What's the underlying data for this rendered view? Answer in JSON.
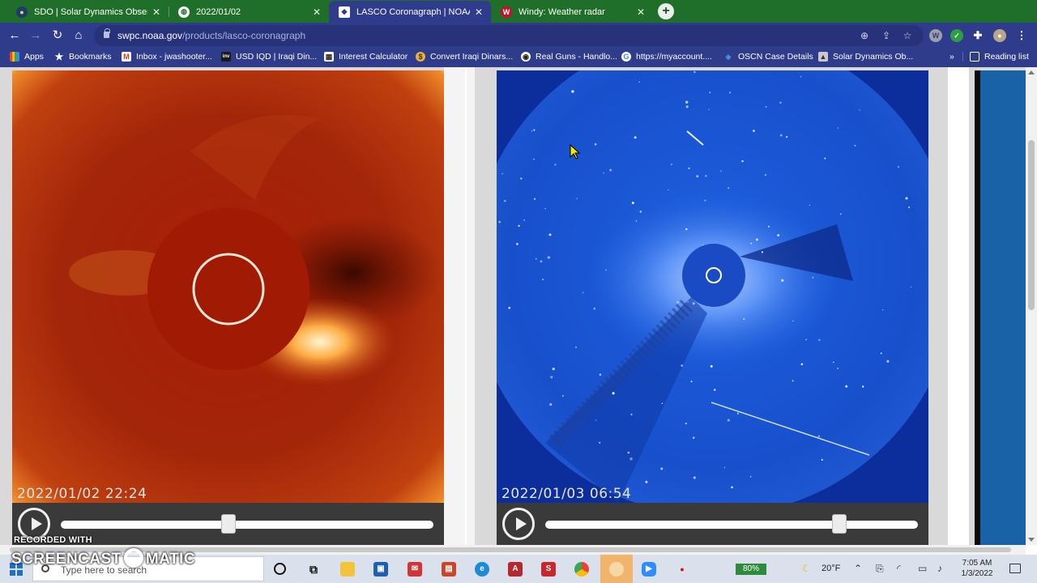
{
  "browser": {
    "tabs": [
      {
        "label": "SDO | Solar Dynamics Observato",
        "favicon": "sdo-globe-icon",
        "active": false
      },
      {
        "label": "2022/01/02",
        "favicon": "globe-icon",
        "active": false
      },
      {
        "label": "LASCO Coronagraph | NOAA / N",
        "favicon": "noaa-icon",
        "active": true
      },
      {
        "label": "Windy: Weather radar",
        "favicon": "windy-icon",
        "active": false
      }
    ],
    "new_tab_symbol": "+",
    "address": {
      "host": "swpc.noaa.gov",
      "path": "/products/lasco-coronagraph"
    },
    "bookmarks": [
      {
        "label": "Apps",
        "icon": "apps-grid-icon"
      },
      {
        "label": "Bookmarks",
        "icon": "star-icon"
      },
      {
        "label": "Inbox - jwashooter...",
        "icon": "gmail-icon"
      },
      {
        "label": "USD IQD | Iraqi Din...",
        "icon": "inv-icon"
      },
      {
        "label": "Interest Calculator",
        "icon": "calculator-icon"
      },
      {
        "label": "Convert Iraqi Dinars...",
        "icon": "currency-icon"
      },
      {
        "label": "Real Guns - Handlo...",
        "icon": "realguns-icon"
      },
      {
        "label": "https://myaccount....",
        "icon": "google-icon"
      },
      {
        "label": "OSCN Case Details",
        "icon": "oscn-icon"
      },
      {
        "label": "Solar Dynamics Ob...",
        "icon": "sdo-icon"
      }
    ],
    "overflow": "»",
    "reading_list": "Reading list"
  },
  "viewer": {
    "left": {
      "timestamp": "2022/01/02  22:24",
      "progress": 0.45,
      "instrument_color": "#c83a10"
    },
    "right": {
      "timestamp": "2022/01/03 06:54",
      "progress": 0.79,
      "instrument_color": "#1d55d6"
    }
  },
  "taskbar": {
    "search_placeholder": "Type here to search",
    "battery": "80%",
    "temperature": "20°F",
    "time": "7:05 AM",
    "date": "1/3/2022"
  },
  "watermark": {
    "recorded": "RECORDED WITH",
    "brand_left": "SCREENCAST",
    "brand_right": "MATIC"
  }
}
